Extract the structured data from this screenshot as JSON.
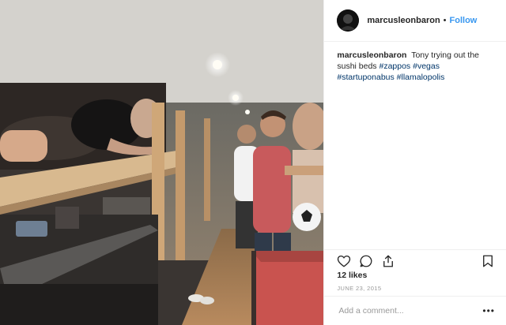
{
  "post": {
    "username": "marcusleonbaron",
    "separator": "•",
    "follow_label": "Follow",
    "caption": {
      "username": "marcusleonbaron",
      "text": "Tony trying out the sushi beds",
      "hashtags": [
        "#zappos",
        "#vegas",
        "#startuponabus",
        "#llamalopolis"
      ]
    },
    "likes": "12 likes",
    "date": "JUNE 23, 2015",
    "comment_placeholder": "Add a comment...",
    "more_label": "•••"
  },
  "icons": {
    "like": "heart-icon",
    "comment": "comment-icon",
    "share": "share-icon",
    "save": "bookmark-icon",
    "avatar": "avatar"
  },
  "colors": {
    "link": "#3897f0",
    "hashtag": "#003569",
    "text": "#262626",
    "muted": "#999999"
  }
}
